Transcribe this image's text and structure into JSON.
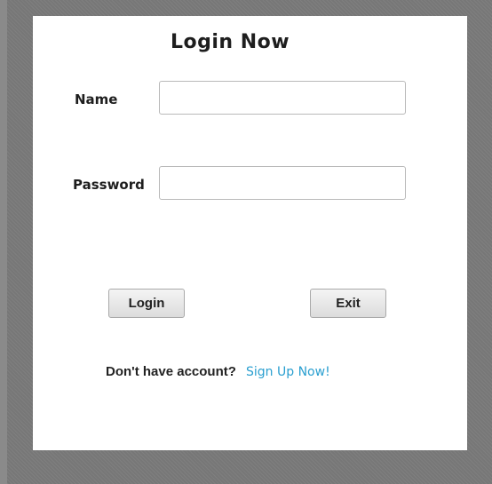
{
  "form": {
    "title": "Login Now",
    "name_label": "Name",
    "name_value": "",
    "password_label": "Password",
    "password_value": "",
    "login_label": "Login",
    "exit_label": "Exit",
    "no_account_text": "Don't have account?",
    "signup_link": "Sign Up Now!"
  },
  "colors": {
    "frame": "#777777",
    "panel": "#ffffff",
    "link": "#2a9fd0",
    "text": "#1e1e1e"
  }
}
